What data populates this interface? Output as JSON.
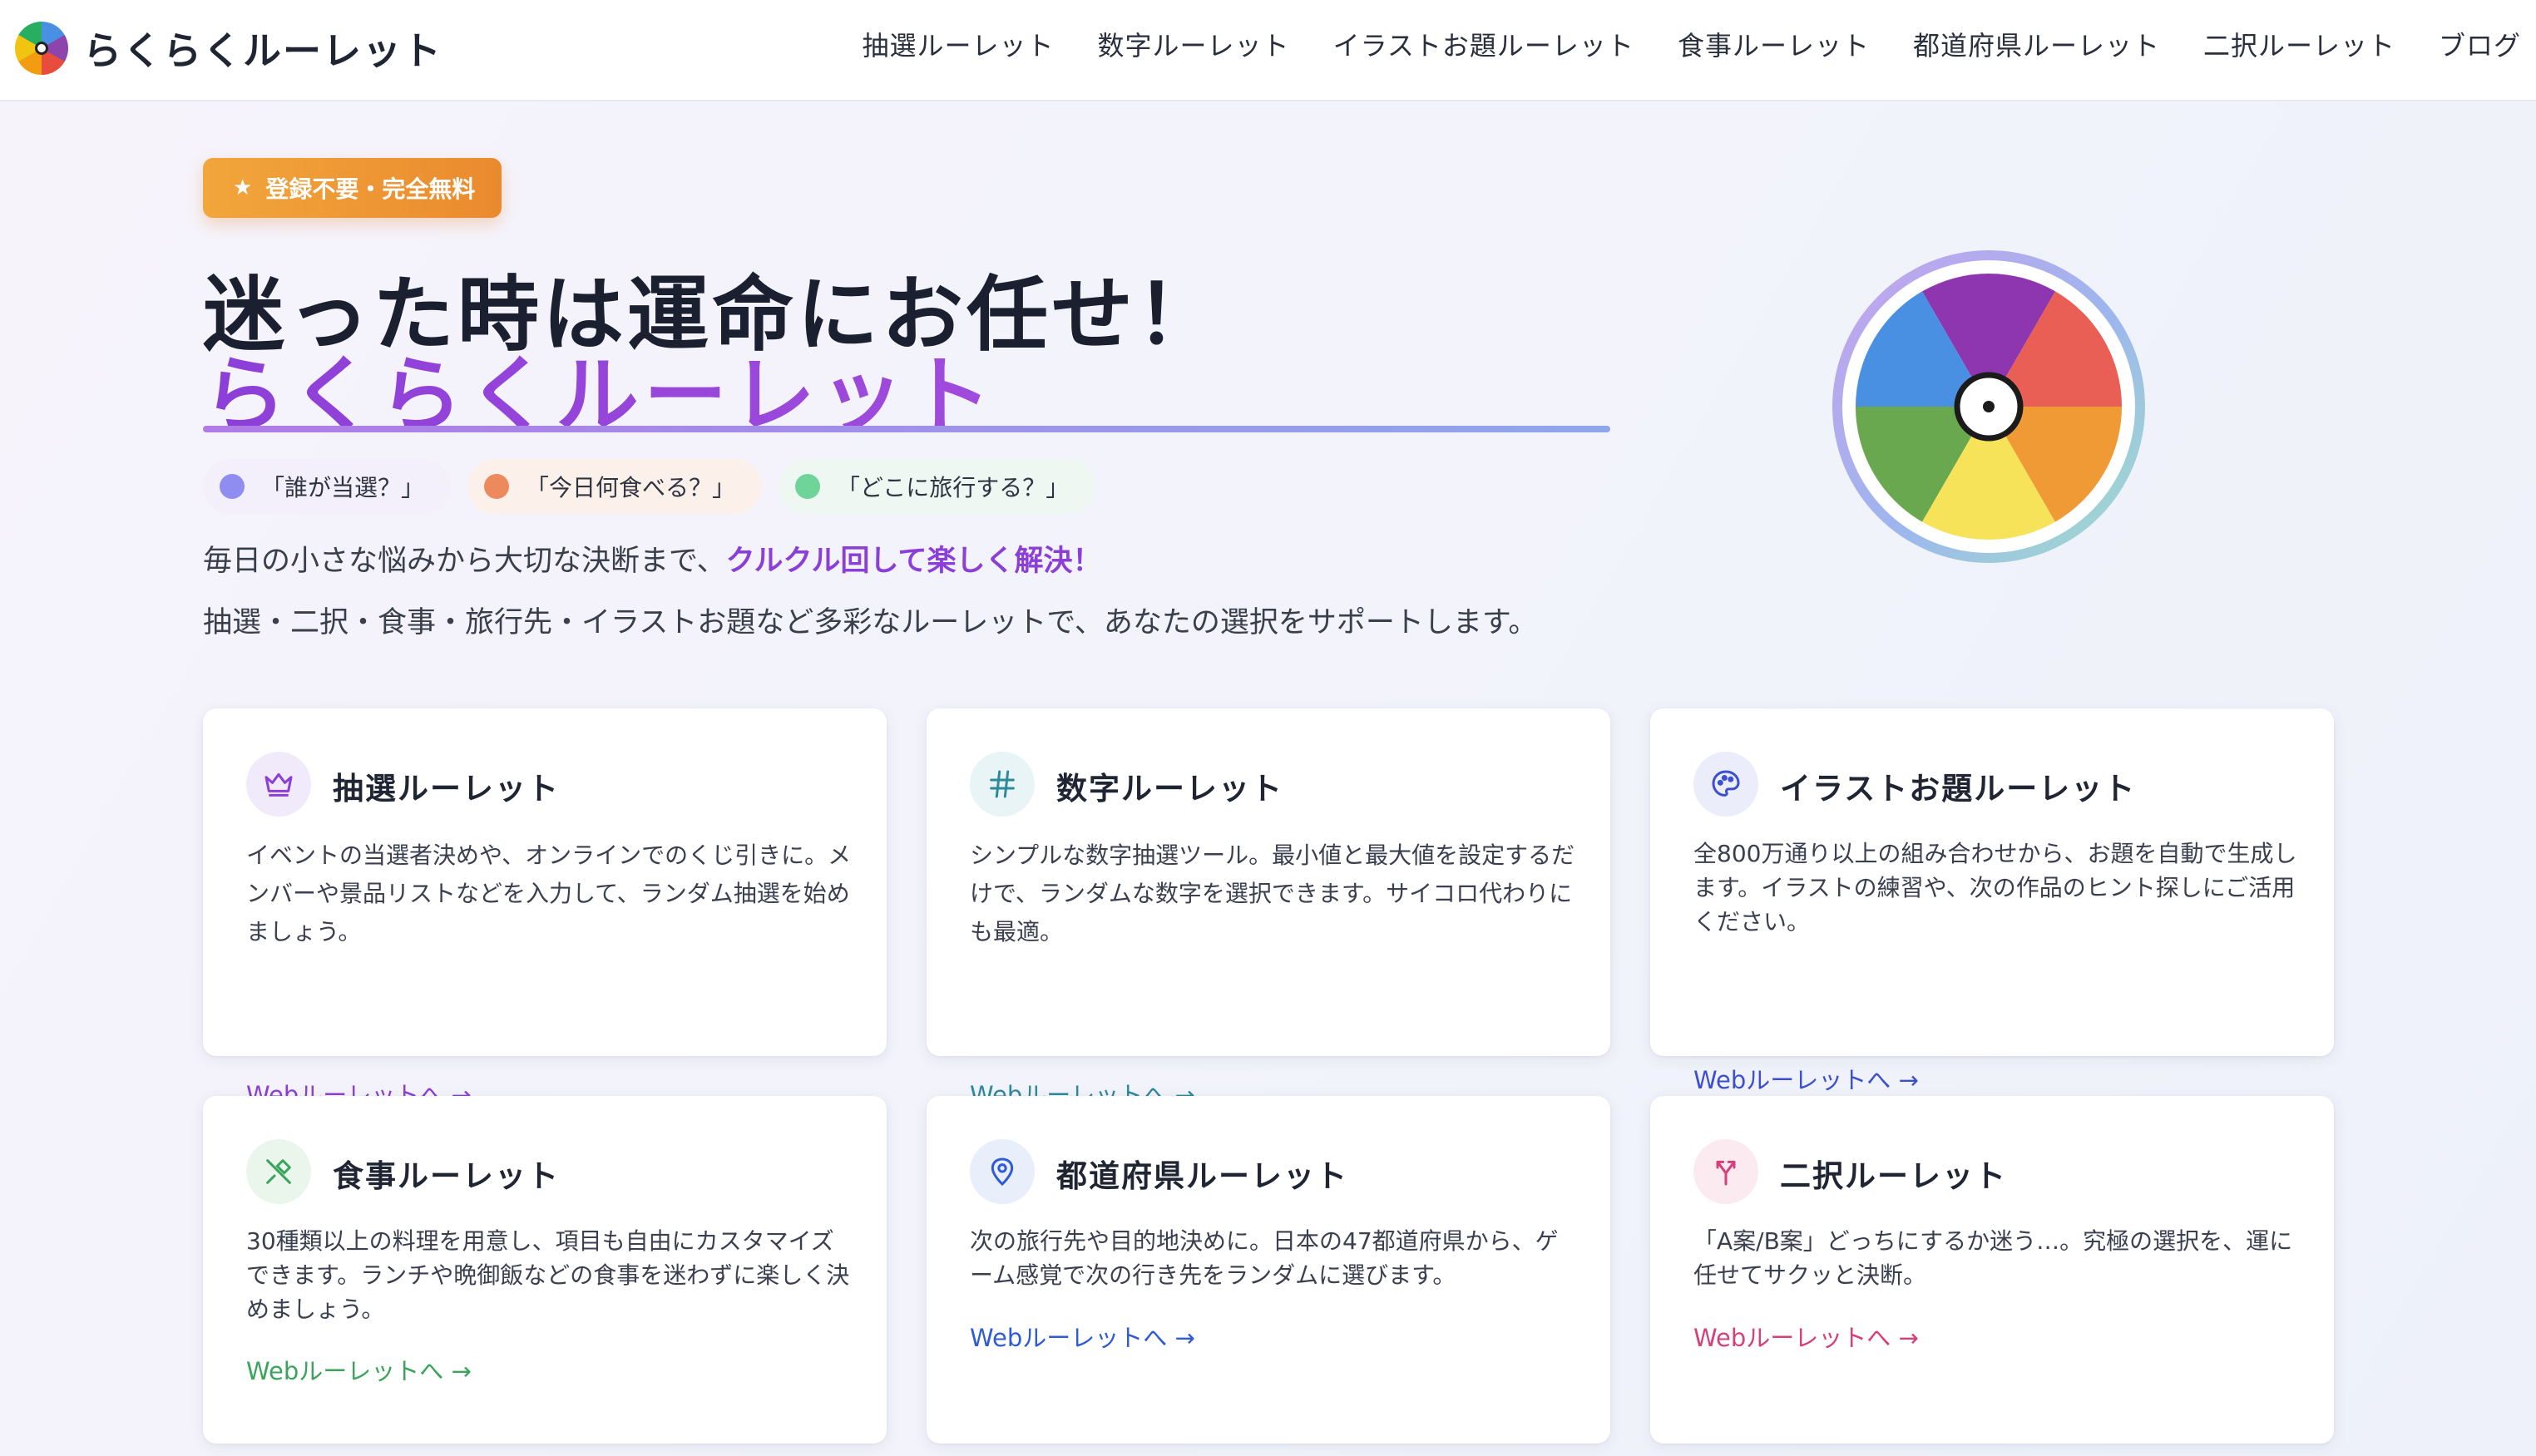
{
  "header": {
    "logo_text": "らくらくルーレット",
    "nav": [
      "抽選ルーレット",
      "数字ルーレット",
      "イラストお題ルーレット",
      "食事ルーレット",
      "都道府県ルーレット",
      "二択ルーレット",
      "ブログ"
    ]
  },
  "hero": {
    "badge": "登録不要・完全無料",
    "title_line1": "迷った時は運命にお任せ！",
    "title_line2": "らくらくルーレット",
    "chips": [
      "「誰が当選？」",
      "「今日何食べる？」",
      "「どこに旅行する？」"
    ],
    "lead_prefix": "毎日の小さな悩みから大切な決断まで、",
    "lead_highlight": "クルクル回して楽しく解決！",
    "lead2": "抽選・二択・食事・旅行先・イラストお題など多彩なルーレットで、あなたの選択をサポートします。"
  },
  "cards": [
    {
      "title": "抽選ルーレット",
      "desc": "イベントの当選者決めや、オンラインでのくじ引きに。メンバーや景品リストなどを入力して、ランダム抽選を始めましょう。",
      "link": "Webルーレットへ →",
      "icon": "crown-icon",
      "color": "#8b3fd6"
    },
    {
      "title": "数字ルーレット",
      "desc": "シンプルな数字抽選ツール。最小値と最大値を設定するだけで、ランダムな数字を選択できます。サイコロ代わりにも最適。",
      "link": "Webルーレットへ →",
      "icon": "hash-icon",
      "color": "#2d8a9a"
    },
    {
      "title": "イラストお題ルーレット",
      "desc": "全800万通り以上の組み合わせから、お題を自動で生成します。イラストの練習や、次の作品のヒント探しにご活用ください。",
      "link": "Webルーレットへ →",
      "icon": "palette-icon",
      "color": "#3b4fd0"
    },
    {
      "title": "食事ルーレット",
      "desc": "30種類以上の料理を用意し、項目も自由にカスタマイズできます。ランチや晩御飯などの食事を迷わずに楽しく決めましょう。",
      "link": "Webルーレットへ →",
      "icon": "utensils-icon",
      "color": "#3aa55a"
    },
    {
      "title": "都道府県ルーレット",
      "desc": "次の旅行先や目的地決めに。日本の47都道府県から、ゲーム感覚で次の行き先をランダムに選びます。",
      "link": "Webルーレットへ →",
      "icon": "map-pin-icon",
      "color": "#2f5bd6"
    },
    {
      "title": "二択ルーレット",
      "desc": "「A案/B案」どっちにするか迷う…。究極の選択を、運に任せてサクッと決断。",
      "link": "Webルーレットへ →",
      "icon": "split-arrow-icon",
      "color": "#d6407a"
    }
  ]
}
